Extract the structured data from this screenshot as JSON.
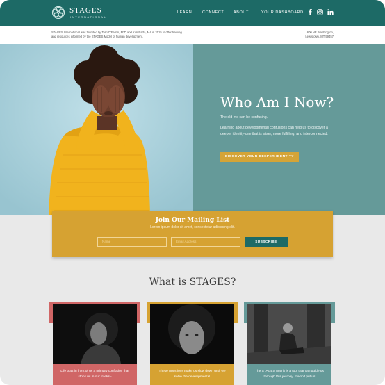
{
  "brand": {
    "name": "STAGES",
    "subtitle": "INTERNATIONAL"
  },
  "nav": {
    "learn": "LEARN",
    "connect": "CONNECT",
    "about": "ABOUT",
    "dashboard": "YOUR DASHBOARD"
  },
  "social": [
    "facebook-icon",
    "instagram-icon",
    "linkedin-icon"
  ],
  "info": {
    "left": "STAGES International was founded by Terri O'Fallon, PhD and Kim Barta, MA in 2015 to offer training and resources informed by the STAGES Model of human development.",
    "right_line1": "600 NE Washington,",
    "right_line2": "Lewistown, MT 59457"
  },
  "hero": {
    "title": "Who Am I Now?",
    "line1": "The old me can be confusing.",
    "paragraph": "Learning about developmental confusions can help us to discover a deeper identity-one that is wiser, more fulfilling, and interconnected.",
    "button": "DISCOVER YOUR DEEPER IDENTITY"
  },
  "mailing": {
    "title": "Join Our Mailing List",
    "subtitle": "Lorem ipsum dolor sit amet, consectetur adipiscing elit.",
    "name_placeholder": "Name",
    "email_placeholder": "Email Address",
    "button": "SUBSCRIBE"
  },
  "section": {
    "title": "What is STAGES?"
  },
  "cards": [
    {
      "text": "Life puts in front of us a primary confusion that stops us in our tracks–",
      "accent": "#d06666"
    },
    {
      "text": "These questions make us slow down until we solve the developmental",
      "accent": "#d6a232"
    },
    {
      "text": "The STAGES Matrix is a tool that can guide us through this journey. It won't put us",
      "accent": "#659a99"
    }
  ],
  "colors": {
    "teal": "#1d6a66",
    "gold": "#d6a232",
    "hero_right": "#659a99",
    "hero_left": "#a7cfda",
    "coral": "#d06666"
  }
}
